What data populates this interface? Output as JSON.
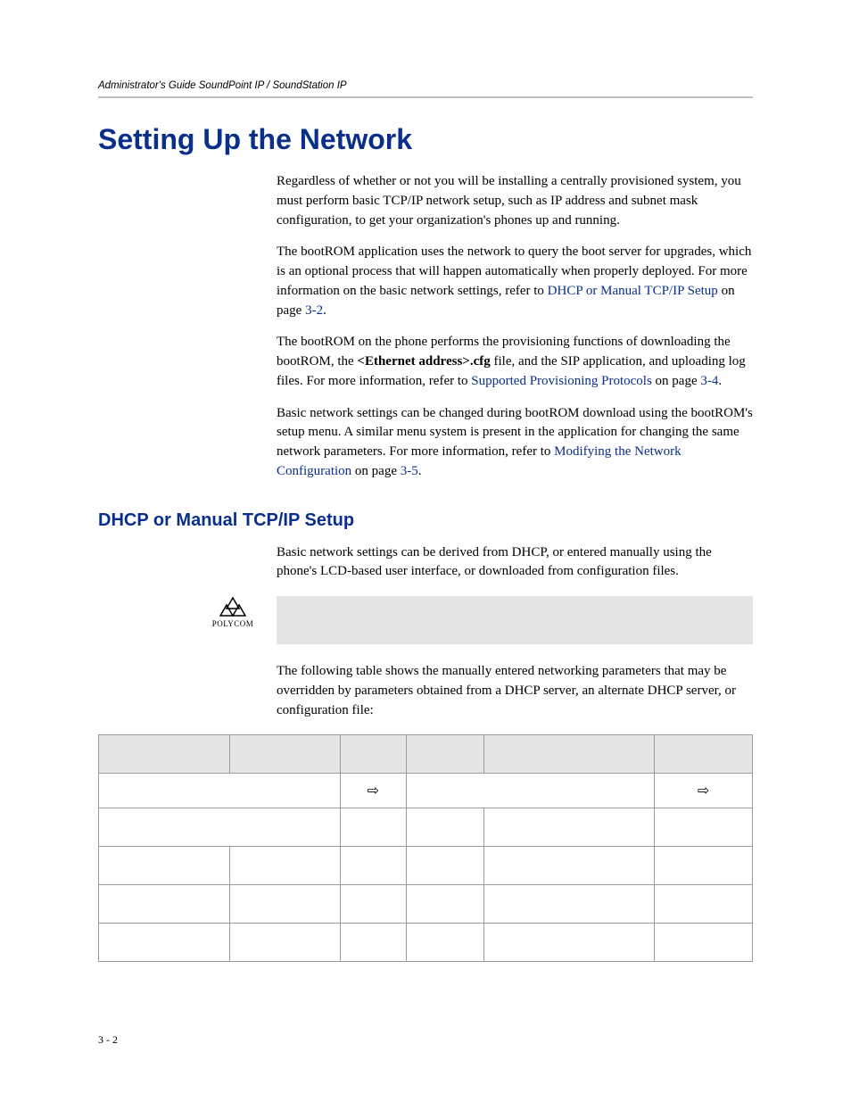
{
  "header": {
    "running_title": "Administrator's Guide SoundPoint IP / SoundStation IP"
  },
  "section": {
    "title": "Setting Up the Network",
    "paragraphs": {
      "p1": "Regardless of whether or not you will be installing a centrally provisioned system, you must perform basic TCP/IP network setup, such as IP address and subnet mask configuration, to get your organization's phones up and running.",
      "p2_pre": "The bootROM application uses the network to query the boot server for upgrades, which is an optional process that will happen automatically when properly deployed. For more information on the basic network settings, refer to ",
      "p2_link": "DHCP or Manual TCP/IP Setup",
      "p2_mid": " on page ",
      "p2_page": "3-2",
      "p2_post": ".",
      "p3_pre": "The bootROM on the phone performs the provisioning functions of downloading the bootROM, the ",
      "p3_bold": "<Ethernet address>.cfg",
      "p3_mid": " file, and the SIP application, and uploading log files. For more information, refer to ",
      "p3_link": "Supported Provisioning Protocols",
      "p3_mid2": " on page ",
      "p3_page": "3-4",
      "p3_post": ".",
      "p4_pre": "Basic network settings can be changed during bootROM download using the bootROM's setup menu. A similar menu system is present in the application for changing the same network parameters. For more information, refer to ",
      "p4_link": "Modifying the Network Configuration",
      "p4_mid": " on page ",
      "p4_page": "3-5",
      "p4_post": "."
    }
  },
  "subsection": {
    "title": "DHCP or Manual TCP/IP Setup",
    "p1": "Basic network settings can be derived from DHCP, or entered manually using the phone's LCD-based user interface, or downloaded from configuration files.",
    "p2": "The following table shows the manually entered networking parameters that may be overridden by parameters obtained from a DHCP server, an alternate DHCP server, or configuration file:"
  },
  "logo": {
    "brand": "POLYCOM"
  },
  "table": {
    "arrow": "⇨"
  },
  "footer": {
    "page_number": "3 - 2"
  }
}
